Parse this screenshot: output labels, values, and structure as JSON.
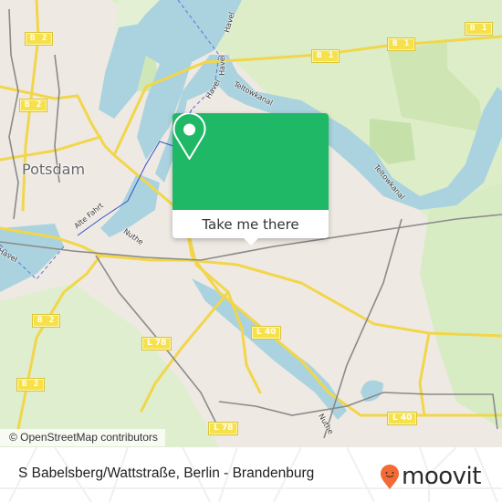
{
  "map": {
    "city_label": "Potsdam",
    "attribution": "© OpenStreetMap contributors",
    "road_shields": [
      {
        "id": "b2-top",
        "label": "B 2"
      },
      {
        "id": "b2-mid",
        "label": "B 2"
      },
      {
        "id": "b2-low",
        "label": "B 2"
      },
      {
        "id": "b2-bottom",
        "label": "B 2"
      },
      {
        "id": "b1-left",
        "label": "B 1"
      },
      {
        "id": "b1-mid",
        "label": "B 1"
      },
      {
        "id": "b1-right",
        "label": "B 1"
      },
      {
        "id": "l78-mid",
        "label": "L 78"
      },
      {
        "id": "l78-bottom",
        "label": "L 78"
      },
      {
        "id": "l40-mid",
        "label": "L 40"
      },
      {
        "id": "l40-bottom",
        "label": "L 40"
      }
    ],
    "water_labels": [
      {
        "id": "havel-top",
        "label": "Havel"
      },
      {
        "id": "havel-mid",
        "label": "Havel"
      },
      {
        "id": "havel-low",
        "label": "Havel"
      },
      {
        "id": "havel-left",
        "label": "Havel"
      },
      {
        "id": "teltowkanal-left",
        "label": "Teltowkanal"
      },
      {
        "id": "teltowkanal-right",
        "label": "Teltowkanal"
      },
      {
        "id": "alte-fahrt",
        "label": "Alte Fahrt"
      },
      {
        "id": "nuthe-top",
        "label": "Nuthe"
      },
      {
        "id": "nuthe-bottom",
        "label": "Nuthe"
      }
    ],
    "colors": {
      "water": "#aad3df",
      "land": "#efe9e3",
      "park": "#d8ecc4",
      "road_major": "#f7e14a",
      "rail": "#8a8a8a"
    }
  },
  "popup": {
    "button_label": "Take me there",
    "icon": "map-pin-icon",
    "color": "#1fb866"
  },
  "footer": {
    "address": "S Babelsberg/Wattstraße, Berlin - Brandenburg",
    "brand": "moovit",
    "brand_icon": "moovit-pin-smile-icon",
    "brand_color": "#f26a36"
  }
}
